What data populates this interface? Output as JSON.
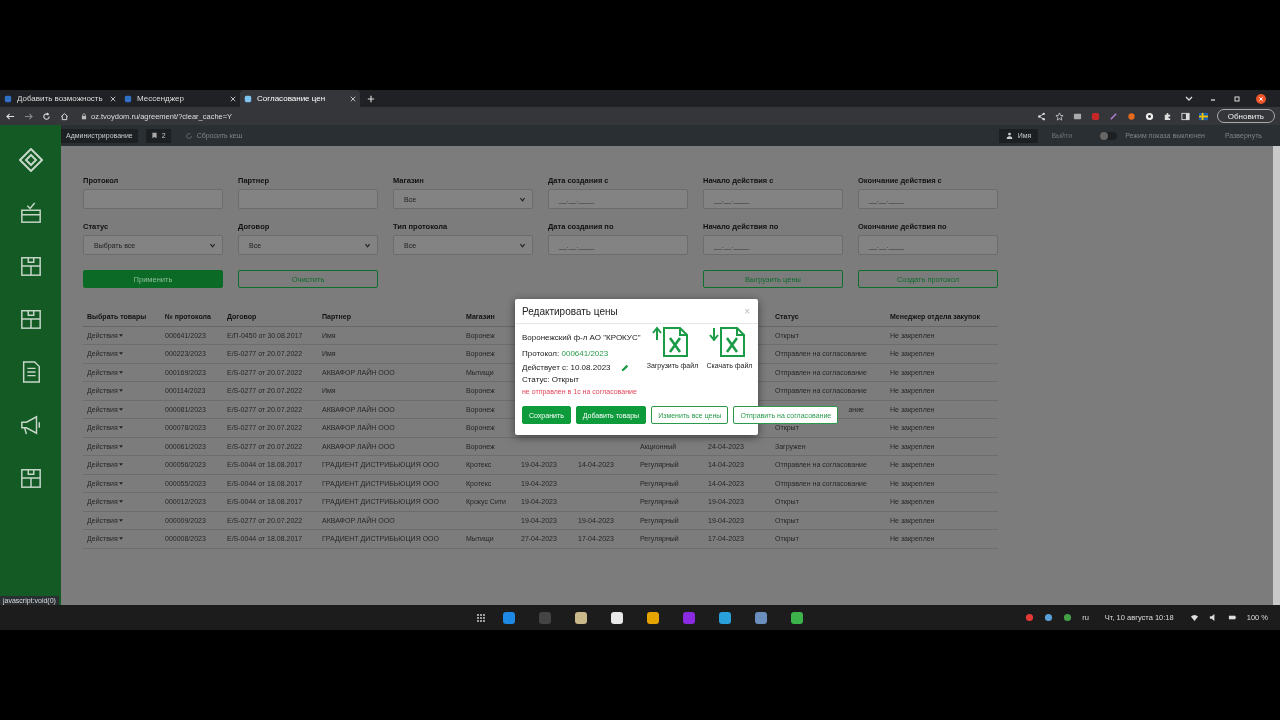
{
  "browser": {
    "tabs": [
      {
        "title": "Добавить возможность",
        "selected": false
      },
      {
        "title": "Мессенджер",
        "selected": false
      },
      {
        "title": "Согласование цен",
        "selected": true
      }
    ],
    "url": "oz.tvoydom.ru/agreement/?clear_cache=Y",
    "update_button": "Обновить"
  },
  "topbar": {
    "admin": "Администрирование",
    "notifications": "2",
    "reset_cache": "Сбросить кеш",
    "user": "Имя",
    "logout": "Выйти",
    "mode": {
      "label": "Режим показа выключен",
      "on": false
    },
    "expand": "Развернуть"
  },
  "filters": [
    {
      "label": "Протокол",
      "kind": "text"
    },
    {
      "label": "Партнер",
      "kind": "text"
    },
    {
      "label": "Магазин",
      "kind": "select",
      "value": "Все"
    },
    {
      "label": "Дата создания с",
      "kind": "date",
      "placeholder": "__.__.____"
    },
    {
      "label": "Начало действия с",
      "kind": "date",
      "placeholder": "__.__.____"
    },
    {
      "label": "Окончание действия с",
      "kind": "date",
      "placeholder": "__.__.____"
    },
    {
      "label": "Статус",
      "kind": "select",
      "value": "Выбрать все"
    },
    {
      "label": "Договор",
      "kind": "select",
      "value": "Все"
    },
    {
      "label": "Тип протокола",
      "kind": "select",
      "value": "Все"
    },
    {
      "label": "Дата создания по",
      "kind": "date",
      "placeholder": "__.__.____"
    },
    {
      "label": "Начало действия по",
      "kind": "date",
      "placeholder": "__.__.____"
    },
    {
      "label": "Окончание действия по",
      "kind": "date",
      "placeholder": "__.__.____"
    }
  ],
  "actions_left": [
    {
      "label": "Применить",
      "kind": "primary"
    },
    {
      "label": "Очистить",
      "kind": "outline"
    }
  ],
  "actions_right": [
    {
      "label": "Выгрузить цены",
      "kind": "outline"
    },
    {
      "label": "Создать протокол",
      "kind": "outline"
    }
  ],
  "table": {
    "columns": [
      "Выбрать товары",
      "№ протокола",
      "Договор",
      "Партнер",
      "Магазин",
      null,
      null,
      null,
      null,
      "Статус",
      "Менеджер отдела закупок"
    ],
    "rows": [
      {
        "cells": [
          "Действия",
          "000641/2023",
          "E/П-0450 от 30.08.2017",
          "Имя",
          "Воронеж",
          null,
          null,
          null,
          null,
          "Открыт",
          "Не закреплен"
        ]
      },
      {
        "cells": [
          "Действия",
          "000223/2023",
          "E/S-0277 от 20.07.2022",
          "Имя",
          "Воронеж",
          null,
          null,
          null,
          null,
          "Отправлен на согласование",
          "Не закреплен"
        ]
      },
      {
        "cells": [
          "Действия",
          "000169/2023",
          "E/S-0277 от 20.07.2022",
          "АКВАФОР ЛАЙН ООО",
          "Мытищи",
          null,
          null,
          null,
          null,
          "Отправлен на согласование",
          "Не закреплен"
        ]
      },
      {
        "cells": [
          "Действия",
          "000114/2023",
          "E/S-0277 от 20.07.2022",
          "Имя",
          "Воронеж",
          null,
          null,
          null,
          null,
          "Отправлен на согласование",
          "Не закреплен"
        ]
      },
      {
        "cells": [
          "Действия",
          "000081/2023",
          "E/S-0277 от 20.07.2022",
          "АКВАФОР ЛАЙН ООО",
          "Воронеж",
          null,
          null,
          null,
          null,
          "ание",
          "Не закреплен"
        ],
        "status_covered": true
      },
      {
        "cells": [
          "Действия",
          "000078/2023",
          "E/S-0277 от 20.07.2022",
          "АКВАФОР ЛАЙН ООО",
          "Воронеж",
          null,
          null,
          null,
          null,
          "Открыт",
          "Не закреплен"
        ]
      },
      {
        "cells": [
          "Действия",
          "000061/2023",
          "E/S-0277 от 20.07.2022",
          "АКВАФОР ЛАЙН ООО",
          "Воронеж",
          null,
          null,
          "Акционный",
          "24-04-2023",
          "Загружен",
          "Не закреплен"
        ]
      },
      {
        "cells": [
          "Действия",
          "000056/2023",
          "E/S-0044 от 18.08.2017",
          "ГРАДИЕНТ ДИСТРИБЬЮЦИЯ ООО",
          "Кротекс",
          "19-04-2023",
          "14-04-2023",
          "Регулярный",
          "14-04-2023",
          "Отправлен на согласование",
          "Не закреплен"
        ]
      },
      {
        "cells": [
          "Действия",
          "000055/2023",
          "E/S-0044 от 18.08.2017",
          "ГРАДИЕНТ ДИСТРИБЬЮЦИЯ ООО",
          "Кротекс",
          "19-04-2023",
          null,
          "Регулярный",
          "14-04-2023",
          "Отправлен на согласование",
          "Не закреплен"
        ]
      },
      {
        "cells": [
          "Действия",
          "000012/2023",
          "E/S-0044 от 18.08.2017",
          "ГРАДИЕНТ ДИСТРИБЬЮЦИЯ ООО",
          "Крокус Сити",
          "19-04-2023",
          null,
          "Регулярный",
          "19-04-2023",
          "Открыт",
          "Не закреплен"
        ]
      },
      {
        "cells": [
          "Действия",
          "000009/2023",
          "E/S-0277 от 20.07.2022",
          "АКВАФОР ЛАЙН ООО",
          null,
          "19-04-2023",
          "19-04-2023",
          "Регулярный",
          "19-04-2023",
          "Открыт",
          "Не закреплен"
        ]
      },
      {
        "cells": [
          "Действия",
          "000008/2023",
          "E/S-0044 от 18.08.2017",
          "ГРАДИЕНТ ДИСТРИБЬЮЦИЯ ООО",
          "Мытищи",
          "27-04-2023",
          "17-04-2023",
          "Регулярный",
          "17-04-2023",
          "Открыт",
          "Не закреплен"
        ]
      }
    ]
  },
  "modal": {
    "title": "Редактировать цены",
    "close": "×",
    "partner": "Воронежский ф-л АО \"КРОКУС\"",
    "protocol_label": "Протокол:",
    "protocol_link": "000641/2023",
    "valid_from": "Действует с: 10.08.2023",
    "status": "Статус: Открыт",
    "warning": "не отправлен в 1с на согласование",
    "file_actions": [
      {
        "label": "Загрузить файл",
        "kind": "upload"
      },
      {
        "label": "Скачать файл",
        "kind": "download"
      }
    ],
    "buttons": [
      {
        "label": "Сохранить",
        "kind": "primary"
      },
      {
        "label": "Добавить товары",
        "kind": "primary"
      },
      {
        "label": "Изменить все цены",
        "kind": "outline"
      },
      {
        "label": "Отправить на согласование",
        "kind": "outline"
      }
    ]
  },
  "status_bar": "javascript:void(0)",
  "taskbar": {
    "lang": "ru",
    "clock": "Чт, 10 августа 10:18",
    "battery": "100 %"
  }
}
